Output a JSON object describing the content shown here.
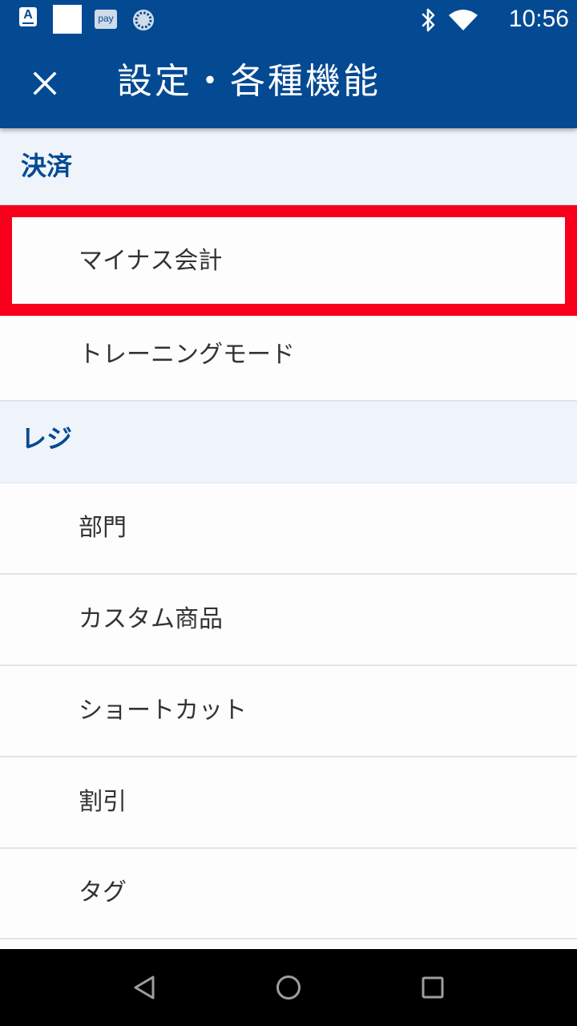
{
  "status_bar": {
    "time": "10:56",
    "notif_a": "A",
    "notif_pay": "pay",
    "icons": [
      "accessibility-a-icon",
      "blank-square-icon",
      "pay-icon",
      "sync-spinner-icon",
      "bluetooth-icon",
      "wifi-icon"
    ]
  },
  "app_bar": {
    "title": "設定・各種機能",
    "close_icon": "close-icon"
  },
  "sections": [
    {
      "header": "決済",
      "items": [
        "マイナス会計",
        "トレーニングモード"
      ]
    },
    {
      "header": "レジ",
      "items": [
        "部門",
        "カスタム商品",
        "ショートカット",
        "割引",
        "タグ"
      ]
    }
  ],
  "highlight": {
    "target": "マイナス会計",
    "color": "#f7001c"
  },
  "colors": {
    "primary": "#044a92",
    "section_background": "#eef4fa",
    "item_text": "#333333"
  },
  "navigation_bar": {
    "icons": [
      "back-icon",
      "home-icon",
      "recents-icon"
    ]
  }
}
